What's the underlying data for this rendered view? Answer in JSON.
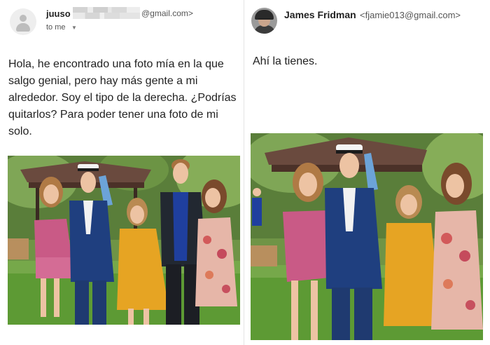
{
  "left_email": {
    "sender_name": "juuso",
    "sender_email_domain": "@gmail.com>",
    "recipient_label": "to me",
    "caret_icon": "chevron-down-icon",
    "body": "Hola, he encontrado una foto mía en la que salgo genial, pero hay más gente a mi alrededor. Soy el tipo de la derecha. ¿Podrías quitarlos? Para poder tener una foto de mi solo."
  },
  "right_email": {
    "sender_name": "James Fridman",
    "sender_email": "<fjamie013@gmail.com>",
    "body": "Ahí la tienes."
  },
  "colors": {
    "grass": "#5d9a34",
    "navy_suit": "#1f3f7f",
    "yellow_dress": "#e6a423",
    "pink_dress": "#c95a86",
    "dark_suit": "#222831",
    "blue_shirt": "#1f3f9e"
  }
}
